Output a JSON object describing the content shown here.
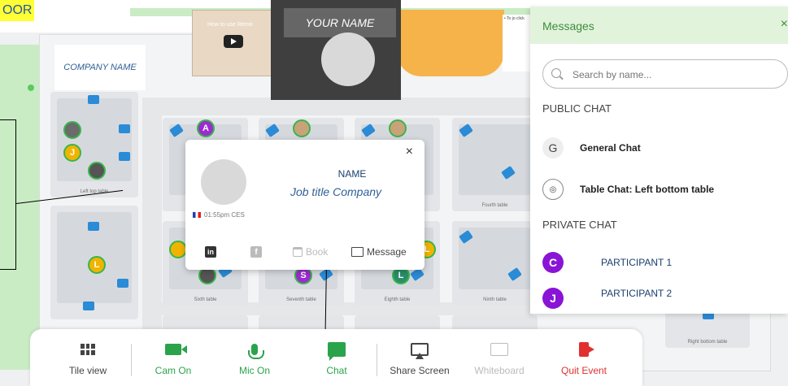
{
  "floor_label": "OOR",
  "company_name": "COMPANY NAME",
  "my_video": {
    "name_label": "YOUR NAME"
  },
  "video_strip": {
    "video_title": "How to use Remo",
    "note_text": "• To jo click"
  },
  "tables": {
    "left_top": "Left top table",
    "fourth": "Fourth table",
    "sixth": "Sixth table",
    "seventh": "Seventh table",
    "eighth": "Eighth table",
    "ninth": "Ninth table",
    "right_bottom": "Right bottom table"
  },
  "seat_avatars": {
    "a": "A",
    "j": "J",
    "l1": "L",
    "l2": "L",
    "s": "S",
    "l3": "L"
  },
  "profile_card": {
    "name": "NAME",
    "job": "Job title Company",
    "time": "01:55pm CES",
    "actions": {
      "linkedin": "in",
      "facebook": "f",
      "book": "Book",
      "message": "Message"
    },
    "close_label": "×"
  },
  "messages": {
    "title": "Messages",
    "close_label": "×",
    "search_placeholder": "Search by name...",
    "public_heading": "PUBLIC CHAT",
    "private_heading": "PRIVATE CHAT",
    "public_chats": [
      {
        "avatar": "G",
        "label": "General Chat"
      },
      {
        "avatar": "◎",
        "label": "Table Chat: Left bottom table"
      }
    ],
    "private_chats": [
      {
        "avatar": "C",
        "label": "PARTICIPANT 1"
      },
      {
        "avatar": "J",
        "label": "PARTICIPANT 2"
      }
    ]
  },
  "toolbar": {
    "tile_view": "Tile view",
    "cam_on": "Cam On",
    "mic_on": "Mic On",
    "chat": "Chat",
    "share_screen": "Share Screen",
    "whiteboard": "Whiteboard",
    "quit_event": "Quit Event"
  },
  "colors": {
    "accent_green": "#2aa34a",
    "quit_red": "#e03030",
    "panel_green": "#e2f3dc",
    "chair_blue": "#2a8bd6",
    "label_blue": "#2f5f96"
  }
}
